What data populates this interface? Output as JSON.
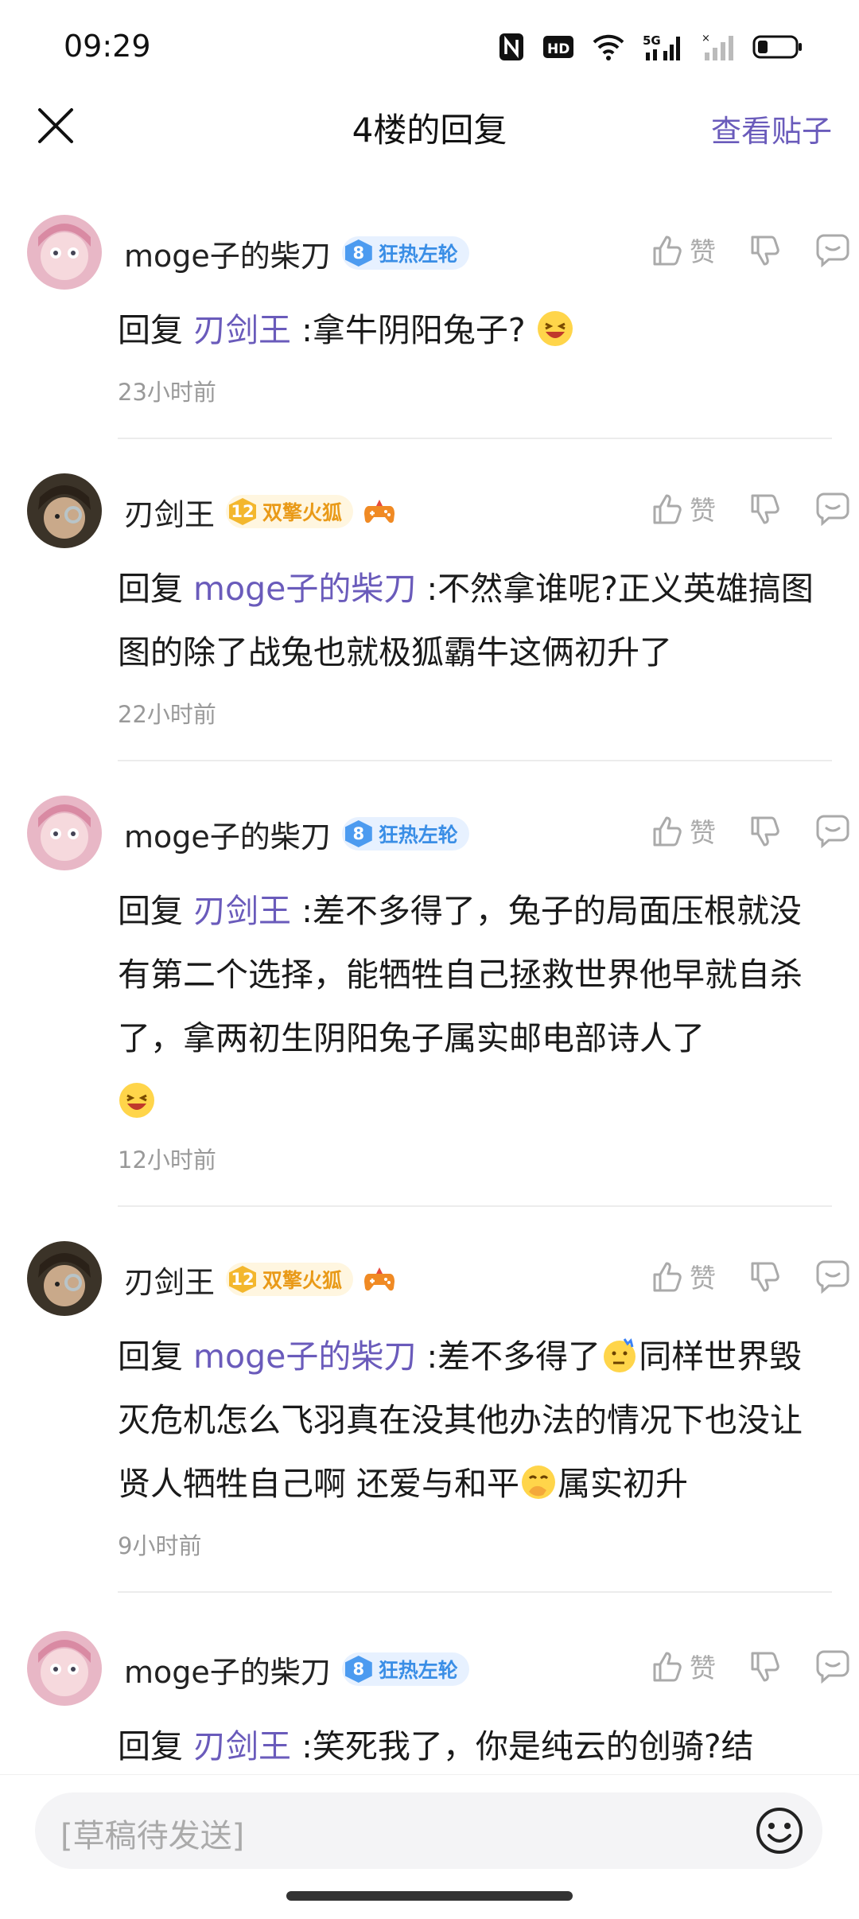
{
  "status_bar": {
    "time": "09:29",
    "icons": [
      "nfc-icon",
      "hd-icon",
      "wifi-icon",
      "5g-signal-icon",
      "signal-icon",
      "battery-icon"
    ]
  },
  "header": {
    "close_icon": "close-icon",
    "title": "4楼的回复",
    "view_post": "查看贴子"
  },
  "actions": {
    "like_label": "赞"
  },
  "replies": [
    {
      "username": "moge子的柴刀",
      "badge_level": "8",
      "badge_text": "狂热左轮",
      "badge_style": "blue",
      "prefix": "回复 ",
      "mention": "刃剑王",
      "text": " :拿牛阴阳兔子?",
      "time": "23小时前"
    },
    {
      "username": "刃剑王",
      "badge_level": "12",
      "badge_text": "双擎火狐",
      "badge_style": "gold",
      "prefix": "回复 ",
      "mention": "moge子的柴刀",
      "text": " :不然拿谁呢?正义英雄搞图图的除了战兔也就极狐霸牛这俩初升了",
      "time": "22小时前"
    },
    {
      "username": "moge子的柴刀",
      "badge_level": "8",
      "badge_text": "狂热左轮",
      "badge_style": "blue",
      "prefix": "回复 ",
      "mention": "刃剑王",
      "text": " :差不多得了，兔子的局面压根就没有第二个选择，能牺牲自己拯救世界他早就自杀了，拿两初生阴阳兔子属实邮电部诗人了",
      "time": "12小时前"
    },
    {
      "username": "刃剑王",
      "badge_level": "12",
      "badge_text": "双擎火狐",
      "badge_style": "gold",
      "prefix": "回复 ",
      "mention": "moge子的柴刀",
      "text_a": " :差不多得了",
      "text_b": "同样世界毁灭危机怎么飞羽真在没其他办法的情况下也没让贤人牺牲自己啊 还爱与和平",
      "text_c": "属实初升",
      "time": "9小时前"
    },
    {
      "username": "moge子的柴刀",
      "badge_level": "8",
      "badge_text": "狂热左轮",
      "badge_style": "blue",
      "prefix": "回复 ",
      "mention": "刃剑王",
      "text": " :笑死我了，你是纯云的创骑?结"
    }
  ],
  "composer": {
    "placeholder": "[草稿待发送]"
  },
  "colors": {
    "accent": "#6a5bbb",
    "badge_blue": "#3a8ee6",
    "badge_gold": "#e99a18",
    "muted": "#999999"
  }
}
